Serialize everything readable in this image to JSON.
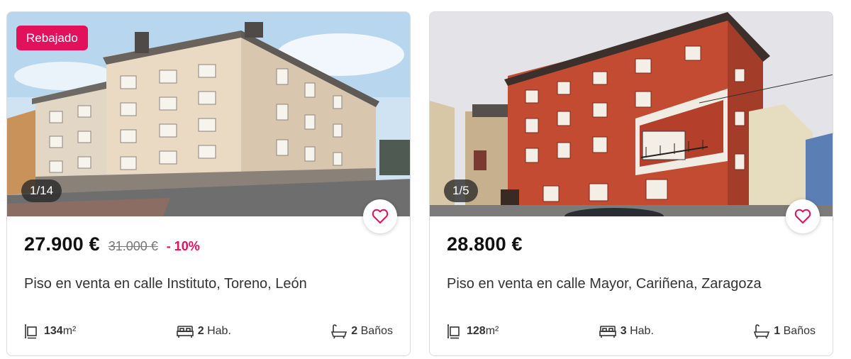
{
  "listings": [
    {
      "badge": "Rebajado",
      "photo_counter": "1/14",
      "price": "27.900 €",
      "old_price": "31.000 €",
      "discount": "- 10%",
      "title": "Piso en venta en calle Instituto, Toreno, León",
      "area_value": "134",
      "area_unit": "m²",
      "rooms_value": "2",
      "rooms_label": "Hab.",
      "baths_value": "2",
      "baths_label": "Baños",
      "favorite_icon": "heart-outline-icon"
    },
    {
      "photo_counter": "1/5",
      "price": "28.800 €",
      "title": "Piso en venta en calle Mayor, Cariñena, Zaragoza",
      "area_value": "128",
      "area_unit": "m²",
      "rooms_value": "3",
      "rooms_label": "Hab.",
      "baths_value": "1",
      "baths_label": "Baños",
      "favorite_icon": "heart-outline-icon"
    }
  ],
  "colors": {
    "accent": "#e3105b",
    "price": "#111111",
    "text": "#333333"
  }
}
